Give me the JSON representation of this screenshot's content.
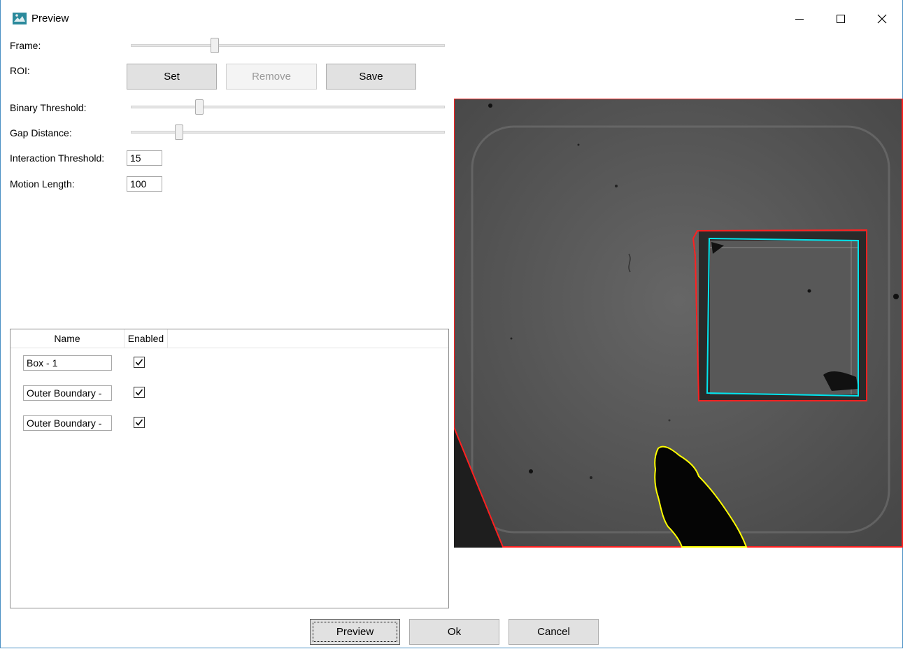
{
  "window": {
    "title": "Preview"
  },
  "labels": {
    "frame": "Frame:",
    "roi": "ROI:",
    "binary_threshold": "Binary Threshold:",
    "gap_distance": "Gap Distance:",
    "interaction_threshold": "Interaction Threshold:",
    "motion_length": "Motion Length:"
  },
  "sliders": {
    "frame": 0.26,
    "binary_threshold": 0.21,
    "gap_distance": 0.145
  },
  "roi_buttons": {
    "set": "Set",
    "remove": "Remove",
    "save": "Save"
  },
  "inputs": {
    "interaction_threshold": "15",
    "motion_length": "100"
  },
  "roi_list": {
    "columns": [
      "Name",
      "Enabled"
    ],
    "rows": [
      {
        "name": "Box - 1",
        "enabled": true
      },
      {
        "name": "Outer Boundary -",
        "enabled": true
      },
      {
        "name": "Outer Boundary -",
        "enabled": true
      }
    ]
  },
  "footer": {
    "preview": "Preview",
    "ok": "Ok",
    "cancel": "Cancel"
  },
  "colors": {
    "roi_outline": "#ff2020",
    "box_outline": "#00e5ee",
    "animal_outline": "#ffff00",
    "arena": "#5a5a5a"
  }
}
